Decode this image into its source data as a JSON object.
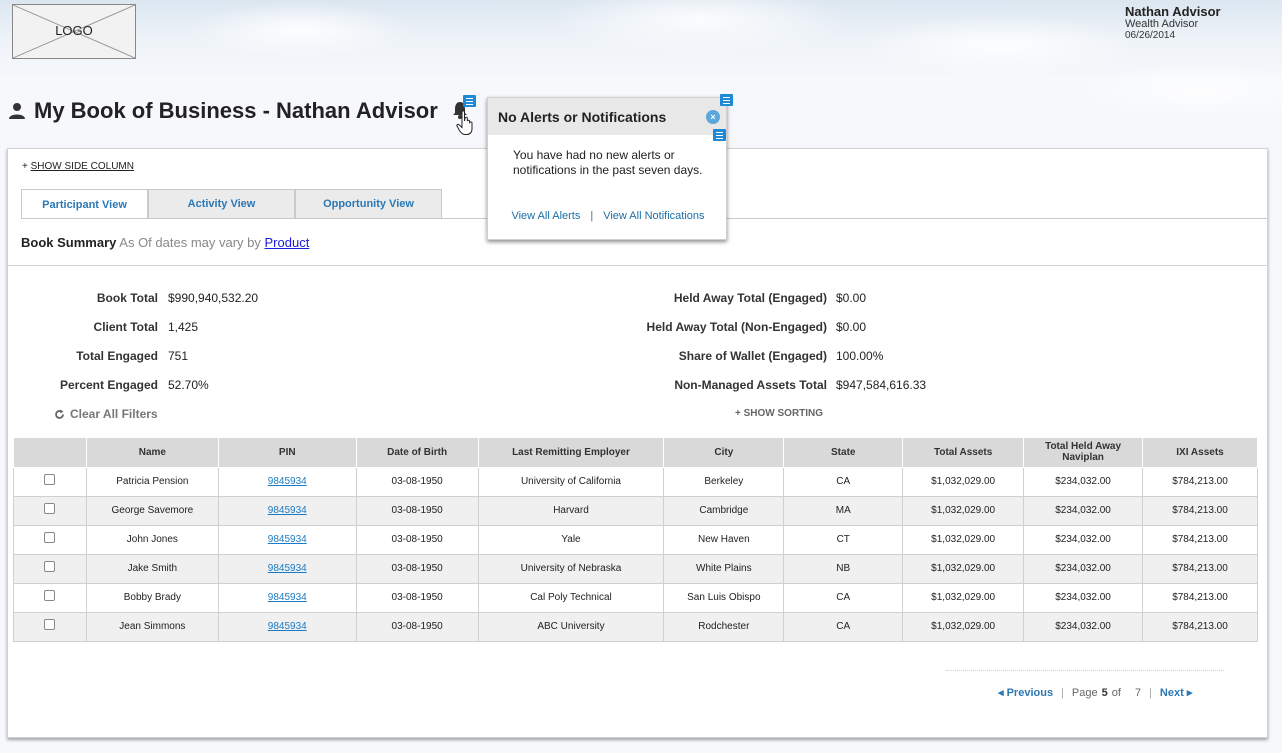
{
  "header": {
    "logo_text": "LOGO",
    "user_name": "Nathan Advisor",
    "user_role": "Wealth Advisor",
    "date": "06/26/2014"
  },
  "page": {
    "title": "My Book of Business - Nathan Advisor"
  },
  "alerts_popup": {
    "title": "No Alerts or Notifications",
    "message": "You have had no new alerts or notifications in the past seven days.",
    "link_alerts": "View All Alerts",
    "separator": "|",
    "link_notifications": "View All Notifications",
    "close_glyph": "×"
  },
  "side_column": {
    "prefix": "+",
    "label": "SHOW SIDE COLUMN"
  },
  "tabs": [
    {
      "label": "Participant View",
      "active": true
    },
    {
      "label": "Activity View",
      "active": false
    },
    {
      "label": "Opportunity View",
      "active": false
    }
  ],
  "summary": {
    "title": "Book Summary",
    "note": "As Of dates may vary by",
    "link": "Product"
  },
  "stats_left": [
    {
      "label": "Book Total",
      "value": "$990,940,532.20"
    },
    {
      "label": "Client Total",
      "value": "1,425"
    },
    {
      "label": "Total Engaged",
      "value": "751"
    },
    {
      "label": "Percent Engaged",
      "value": "52.70%"
    }
  ],
  "stats_right": [
    {
      "label": "Held Away Total (Engaged)",
      "value": "$0.00"
    },
    {
      "label": "Held Away Total (Non-Engaged)",
      "value": "$0.00"
    },
    {
      "label": "Share of Wallet (Engaged)",
      "value": "100.00%"
    },
    {
      "label": "Non-Managed Assets Total",
      "value": "$947,584,616.33"
    }
  ],
  "filters": {
    "clear_label": "Clear All Filters",
    "show_sorting": "+ SHOW SORTING"
  },
  "table": {
    "columns": [
      "",
      "Name",
      "PIN",
      "Date of Birth",
      "Last Remitting Employer",
      "City",
      "State",
      "Total Assets",
      "Total Held Away Naviplan",
      "IXI Assets"
    ],
    "rows": [
      [
        "Patricia Pension",
        "9845934",
        "03-08-1950",
        "University of California",
        "Berkeley",
        "CA",
        "$1,032,029.00",
        "$234,032.00",
        "$784,213.00"
      ],
      [
        "George Savemore",
        "9845934",
        "03-08-1950",
        "Harvard",
        "Cambridge",
        "MA",
        "$1,032,029.00",
        "$234,032.00",
        "$784,213.00"
      ],
      [
        "John Jones",
        "9845934",
        "03-08-1950",
        "Yale",
        "New Haven",
        "CT",
        "$1,032,029.00",
        "$234,032.00",
        "$784,213.00"
      ],
      [
        "Jake Smith",
        "9845934",
        "03-08-1950",
        "University of Nebraska",
        "White Plains",
        "NB",
        "$1,032,029.00",
        "$234,032.00",
        "$784,213.00"
      ],
      [
        "Bobby Brady",
        "9845934",
        "03-08-1950",
        "Cal Poly Technical",
        "San Luis Obispo",
        "CA",
        "$1,032,029.00",
        "$234,032.00",
        "$784,213.00"
      ],
      [
        "Jean Simmons",
        "9845934",
        "03-08-1950",
        "ABC University",
        "Rodchester",
        "CA",
        "$1,032,029.00",
        "$234,032.00",
        "$784,213.00"
      ]
    ]
  },
  "pagination": {
    "previous": "Previous",
    "page_label": "Page",
    "current": "5",
    "of_label": "of",
    "total": "7",
    "next": "Next"
  },
  "colors": {
    "link_blue": "#2b78b5",
    "note_icon_blue": "#1e8ad6",
    "header_gray": "#d9d9d9"
  },
  "icons": [
    "person-icon",
    "bell-icon",
    "hand-cursor-icon",
    "note-icon",
    "close-icon",
    "refresh-icon",
    "chevron-left-icon",
    "chevron-right-icon"
  ]
}
